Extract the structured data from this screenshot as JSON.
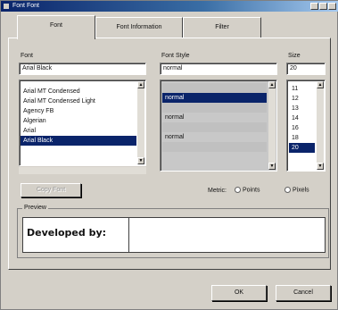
{
  "window": {
    "title": "Font Font"
  },
  "tabs": [
    {
      "label": "Font"
    },
    {
      "label": "Font Information"
    },
    {
      "label": "Filter"
    }
  ],
  "font": {
    "label": "Font",
    "value": "Arial Black",
    "items": [
      "Arial MT Condensed",
      "Arial MT Condensed Light",
      "Agency FB",
      "Algerian",
      "Arial",
      "Arial Black"
    ],
    "selected_index": 5
  },
  "font_style": {
    "label": "Font Style",
    "value": "normal",
    "items": [
      "",
      "normal",
      "",
      "normal",
      "",
      "normal",
      ""
    ],
    "selected_index": 1
  },
  "size": {
    "label": "Size",
    "value": "20",
    "items": [
      "11",
      "12",
      "13",
      "14",
      "16",
      "18",
      "20"
    ],
    "selected_index": 6
  },
  "buttons": {
    "apply": "Copy Font",
    "ok": "OK",
    "cancel": "Cancel"
  },
  "metric": {
    "label": "Metric:",
    "options": [
      "Points",
      "Pixels"
    ]
  },
  "preview": {
    "label": "Preview",
    "text": "Developed by:"
  }
}
